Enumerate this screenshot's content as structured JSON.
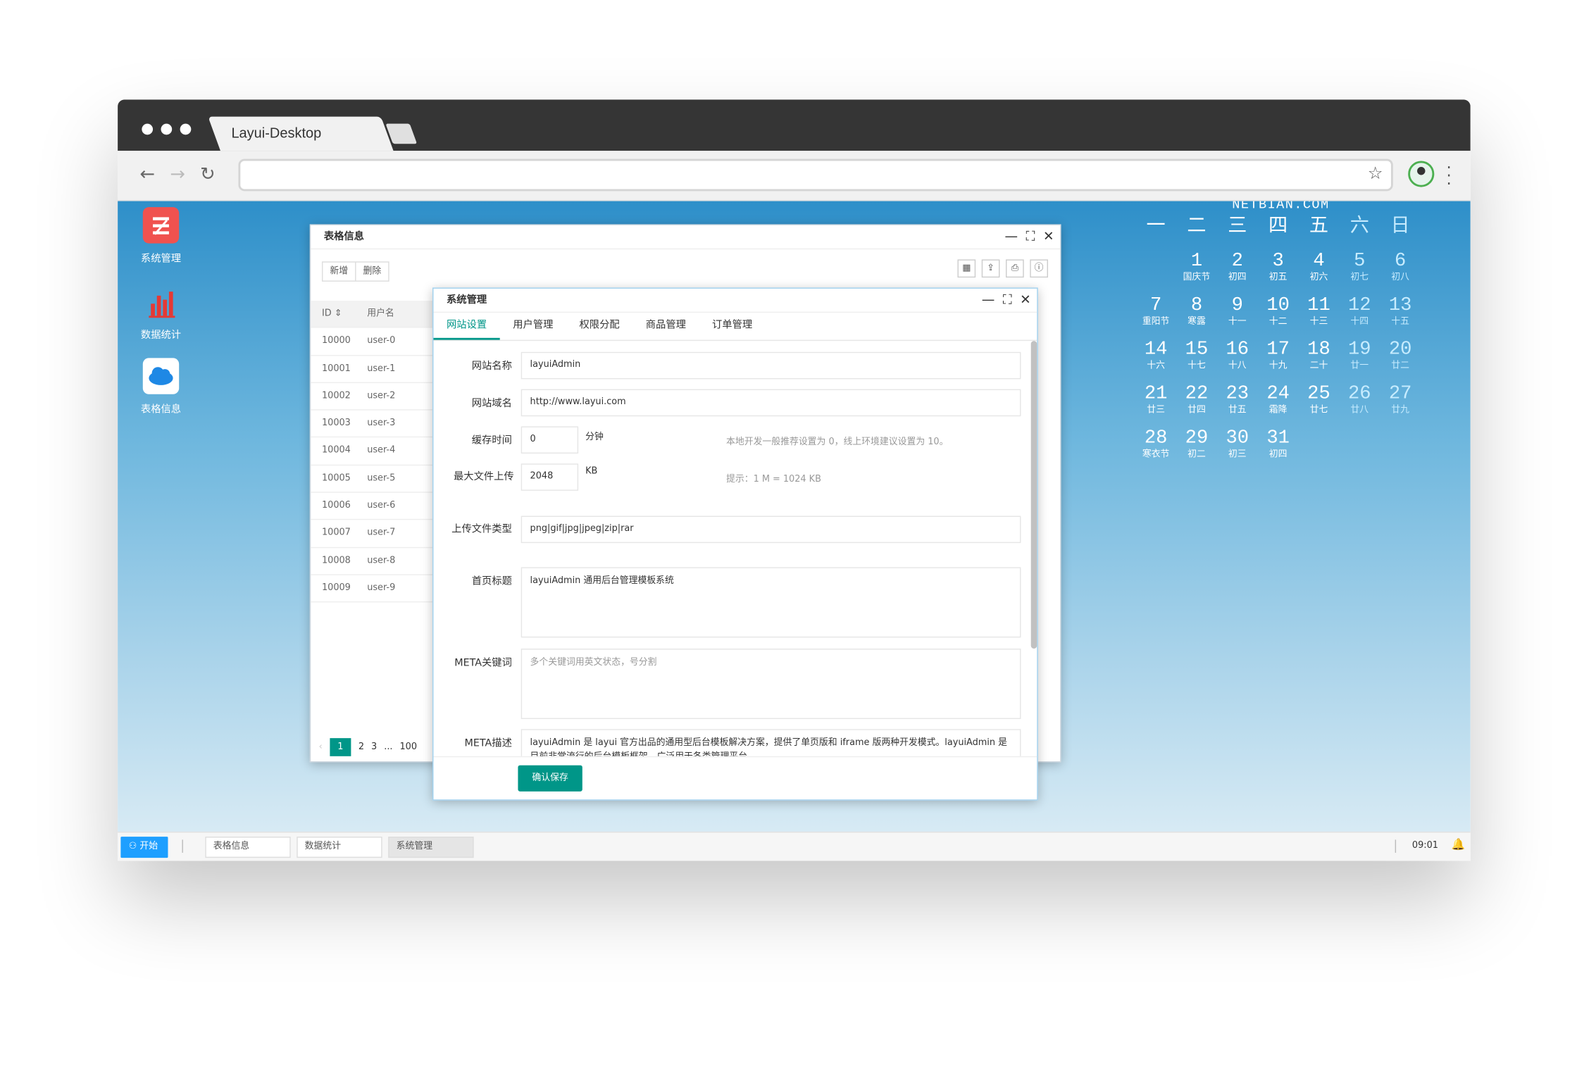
{
  "browser": {
    "tab_title": "Layui-Desktop",
    "address": ""
  },
  "desktop_icons": [
    {
      "label": "系统管理",
      "color": "#f25454"
    },
    {
      "label": "数据统计",
      "color": "#e53935"
    },
    {
      "label": "表格信息",
      "color": "#1e88e5"
    }
  ],
  "calendar": {
    "brand": "NETBIAN.COM",
    "weekdays": [
      "一",
      "二",
      "三",
      "四",
      "五",
      "六",
      "日"
    ],
    "weeks": [
      [
        null,
        {
          "d": "1",
          "l": "国庆节"
        },
        {
          "d": "2",
          "l": "初四"
        },
        {
          "d": "3",
          "l": "初五"
        },
        {
          "d": "4",
          "l": "初六"
        },
        {
          "d": "5",
          "l": "初七"
        },
        {
          "d": "6",
          "l": "初八"
        }
      ],
      [
        {
          "d": "7",
          "l": "重阳节"
        },
        {
          "d": "8",
          "l": "寒露"
        },
        {
          "d": "9",
          "l": "十一"
        },
        {
          "d": "10",
          "l": "十二"
        },
        {
          "d": "11",
          "l": "十三"
        },
        {
          "d": "12",
          "l": "十四"
        },
        {
          "d": "13",
          "l": "十五"
        }
      ],
      [
        {
          "d": "14",
          "l": "十六"
        },
        {
          "d": "15",
          "l": "十七"
        },
        {
          "d": "16",
          "l": "十八"
        },
        {
          "d": "17",
          "l": "十九"
        },
        {
          "d": "18",
          "l": "二十"
        },
        {
          "d": "19",
          "l": "廿一"
        },
        {
          "d": "20",
          "l": "廿二"
        }
      ],
      [
        {
          "d": "21",
          "l": "廿三"
        },
        {
          "d": "22",
          "l": "廿四"
        },
        {
          "d": "23",
          "l": "廿五"
        },
        {
          "d": "24",
          "l": "霜降"
        },
        {
          "d": "25",
          "l": "廿七"
        },
        {
          "d": "26",
          "l": "廿八"
        },
        {
          "d": "27",
          "l": "廿九"
        }
      ],
      [
        {
          "d": "28",
          "l": "寒衣节"
        },
        {
          "d": "29",
          "l": "初二"
        },
        {
          "d": "30",
          "l": "初三"
        },
        {
          "d": "31",
          "l": "初四"
        },
        null,
        null,
        null
      ]
    ]
  },
  "table_window": {
    "title": "表格信息",
    "toolbar": {
      "add": "新增",
      "delete": "删除"
    },
    "columns": [
      "ID",
      "用户名"
    ],
    "rows": [
      [
        "10000",
        "user-0"
      ],
      [
        "10001",
        "user-1"
      ],
      [
        "10002",
        "user-2"
      ],
      [
        "10003",
        "user-3"
      ],
      [
        "10004",
        "user-4"
      ],
      [
        "10005",
        "user-5"
      ],
      [
        "10006",
        "user-6"
      ],
      [
        "10007",
        "user-7"
      ],
      [
        "10008",
        "user-8"
      ],
      [
        "10009",
        "user-9"
      ]
    ],
    "pager": {
      "current": "1",
      "pages": [
        "2",
        "3"
      ],
      "ellipsis": "...",
      "last": "100"
    }
  },
  "system_window": {
    "title": "系统管理",
    "tabs": [
      "网站设置",
      "用户管理",
      "权限分配",
      "商品管理",
      "订单管理"
    ],
    "form": {
      "site_name": {
        "label": "网站名称",
        "value": "layuiAdmin"
      },
      "site_domain": {
        "label": "网站域名",
        "value": "http://www.layui.com"
      },
      "cache": {
        "label": "缓存时间",
        "value": "0",
        "unit": "分钟",
        "note": "本地开发一般推荐设置为 0，线上环境建议设置为 10。"
      },
      "max_file": {
        "label": "最大文件上传",
        "value": "2048",
        "unit": "KB",
        "note": "提示：1 M = 1024 KB"
      },
      "file_types": {
        "label": "上传文件类型",
        "value": "png|gif|jpg|jpeg|zip|rar"
      },
      "home_title": {
        "label": "首页标题",
        "value": "layuiAdmin 通用后台管理模板系统"
      },
      "meta_keywords": {
        "label": "META关键词",
        "placeholder": "多个关键词用英文状态，号分割"
      },
      "meta_desc": {
        "label": "META描述",
        "value": "layuiAdmin 是 layui 官方出品的通用型后台模板解决方案，提供了单页版和 iframe 版两种开发模式。layuiAdmin 是目前非常流行的后台模板框架，广泛用于各类管理平台。"
      }
    },
    "save": "确认保存"
  },
  "taskbar": {
    "start": "开始",
    "items": [
      "表格信息",
      "数据统计",
      "系统管理"
    ],
    "time": "09:01"
  }
}
